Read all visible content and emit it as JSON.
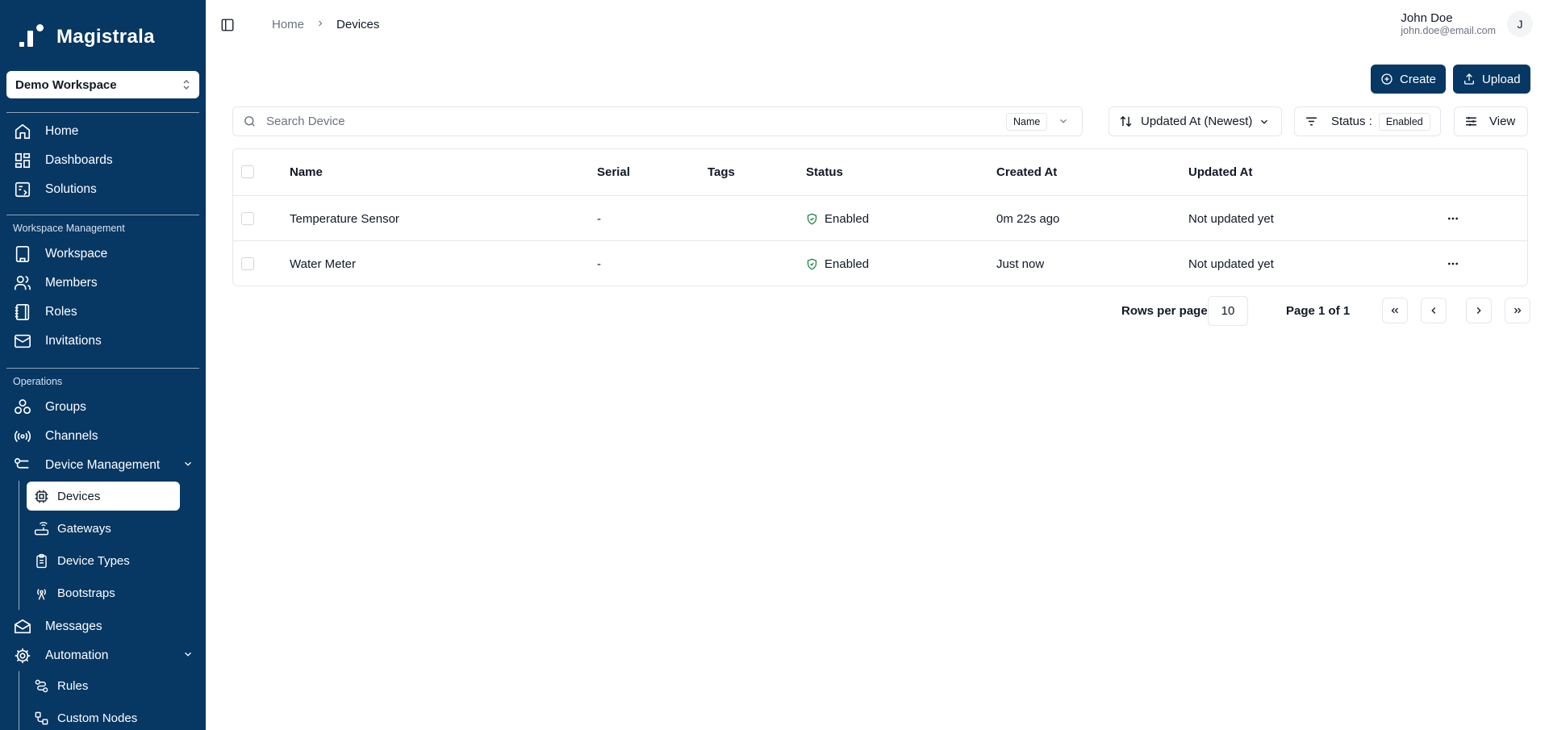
{
  "brand": {
    "name": "Magistrala"
  },
  "workspace_selector": {
    "value": "Demo Workspace"
  },
  "sidebar": {
    "main": [
      {
        "label": "Home",
        "icon": "home-icon"
      },
      {
        "label": "Dashboards",
        "icon": "dashboards-icon"
      },
      {
        "label": "Solutions",
        "icon": "solutions-icon"
      }
    ],
    "workspace_section_label": "Workspace Management",
    "workspace_items": [
      {
        "label": "Workspace",
        "icon": "building-icon"
      },
      {
        "label": "Members",
        "icon": "users-icon"
      },
      {
        "label": "Roles",
        "icon": "notebook-icon"
      },
      {
        "label": "Invitations",
        "icon": "mail-icon"
      }
    ],
    "operations_section_label": "Operations",
    "operations_items": [
      {
        "label": "Groups",
        "icon": "groups-icon"
      },
      {
        "label": "Channels",
        "icon": "broadcast-icon"
      },
      {
        "label": "Device Management",
        "icon": "workflow-icon"
      }
    ],
    "device_sub_items": [
      {
        "label": "Devices",
        "icon": "cpu-icon",
        "active": true
      },
      {
        "label": "Gateways",
        "icon": "router-icon"
      },
      {
        "label": "Device Types",
        "icon": "clipboard-icon"
      },
      {
        "label": "Bootstraps",
        "icon": "antenna-icon"
      }
    ],
    "after_items": [
      {
        "label": "Messages",
        "icon": "mail-open-icon"
      },
      {
        "label": "Automation",
        "icon": "cog-icon"
      }
    ],
    "automation_sub_items": [
      {
        "label": "Rules",
        "icon": "route-icon"
      },
      {
        "label": "Custom Nodes",
        "icon": "nodes-icon"
      }
    ]
  },
  "header": {
    "breadcrumb": [
      "Home",
      "Devices"
    ],
    "user": {
      "name": "John Doe",
      "email": "john.doe@email.com",
      "initial": "J"
    }
  },
  "actions": {
    "create": "Create",
    "upload": "Upload"
  },
  "toolbar": {
    "search_placeholder": "Search Device",
    "search_field": "Name",
    "sort": "Updated At (Newest)",
    "filter_label": "Status :",
    "filter_value": "Enabled",
    "view": "View"
  },
  "table": {
    "columns": [
      "Name",
      "Serial",
      "Tags",
      "Status",
      "Created At",
      "Updated At"
    ],
    "rows": [
      {
        "name": "Temperature Sensor",
        "serial": "-",
        "tags": "",
        "status": "Enabled",
        "created_at": "0m 22s ago",
        "updated_at": "Not updated yet"
      },
      {
        "name": "Water Meter",
        "serial": "-",
        "tags": "",
        "status": "Enabled",
        "created_at": "Just now",
        "updated_at": "Not updated yet"
      }
    ]
  },
  "pagination": {
    "rows_per_page_label": "Rows per page",
    "rows_per_page": "10",
    "page_label": "Page 1 of 1"
  },
  "colors": {
    "sidebar_bg": "#073763",
    "primary": "#073763",
    "status_enabled": "#15803d"
  }
}
